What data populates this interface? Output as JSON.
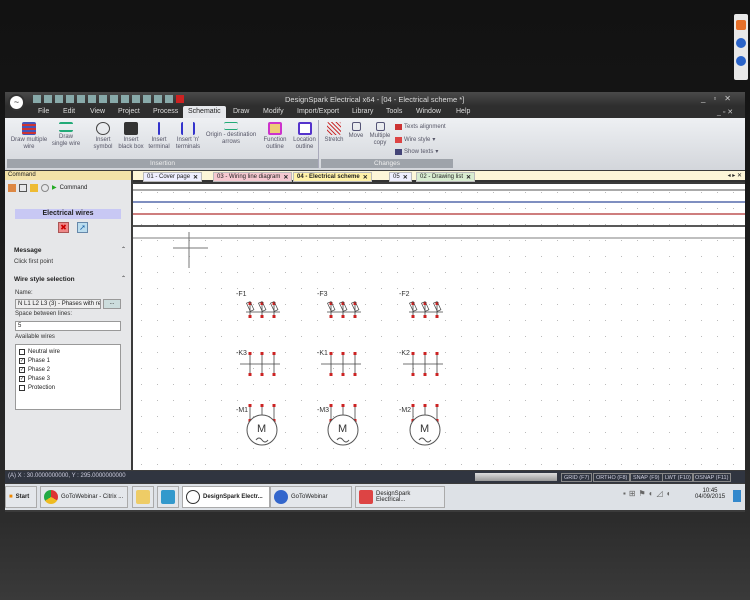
{
  "app": {
    "title": "DesignSpark Electrical x64 - [04 - Electrical scheme *]"
  },
  "menu": [
    "File",
    "Edit",
    "View",
    "Project",
    "Process",
    "Schematic",
    "Draw",
    "Modify",
    "Import/Export",
    "Library",
    "Tools",
    "Window",
    "Help"
  ],
  "ribbon": {
    "insertion": {
      "label": "Insertion",
      "buttons": [
        "Draw multiple wire",
        "Draw single wire",
        "Insert symbol",
        "Insert black box",
        "Insert terminal",
        "Insert 'n' terminals",
        "Origin - destination arrows",
        "Function outline",
        "Location outline"
      ]
    },
    "changes": {
      "label": "Changes",
      "buttons": [
        "Stretch",
        "Move",
        "Multiple copy"
      ],
      "small": [
        "Texts alignment",
        "Wire style",
        "Show texts"
      ]
    }
  },
  "doc_tabs": [
    "01 - Cover page",
    "03 - Wiring line diagram",
    "04 - Electrical scheme",
    "05",
    "02 - Drawing list"
  ],
  "panel": {
    "header": "Command",
    "tab_label": "Command",
    "title": "Electrical wires",
    "message_heading": "Message",
    "message": "Click first point",
    "wire_heading": "Wire style selection",
    "name_label": "Name:",
    "name_value": "N L1 L2 L3 (3) - Phases with rec",
    "browse": "...",
    "space_label": "Space between lines:",
    "space_value": "5",
    "available_label": "Available wires",
    "wires": [
      {
        "label": "Neutral wire",
        "checked": false
      },
      {
        "label": "Phase 1",
        "checked": true
      },
      {
        "label": "Phase 2",
        "checked": true
      },
      {
        "label": "Phase 3",
        "checked": true
      },
      {
        "label": "Protection",
        "checked": false
      }
    ]
  },
  "canvas": {
    "fuses": [
      "-F1",
      "-F3",
      "-F2"
    ],
    "contactors": [
      "-K3",
      "-K1",
      "-K2"
    ],
    "motors": [
      "-M1",
      "-M3",
      "-M2"
    ],
    "motor_letter": "M"
  },
  "status": {
    "coords": "(A) X : 30.0000000000, Y : 295.0000000000",
    "toggles": [
      "GRID (F7)",
      "ORTHO (F8)",
      "SNAP (F9)",
      "LWT (F10)",
      "OSNAP (F11)"
    ]
  },
  "taskbar": {
    "start": "Start",
    "items": [
      "GoToWebinar - Citrix ...",
      "DesignSpark Electr...",
      "GoToWebinar",
      "DesignSpark Electrical..."
    ],
    "time": "10:45",
    "date": "04/09/2015"
  }
}
